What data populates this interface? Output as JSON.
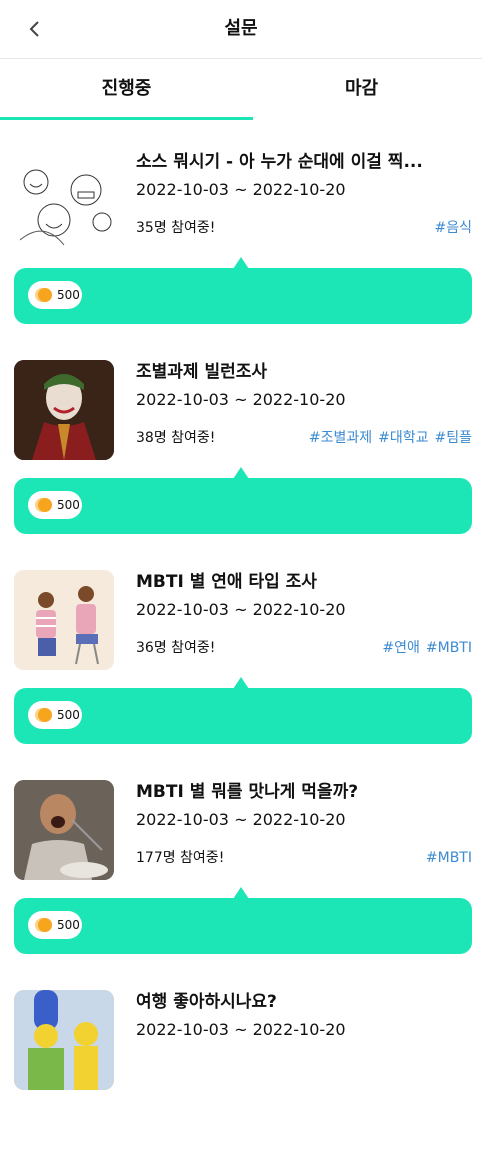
{
  "header": {
    "title": "설문",
    "back_icon": "chevron-left-icon"
  },
  "tabs": [
    {
      "label": "진행중",
      "active": true
    },
    {
      "label": "마감",
      "active": false
    }
  ],
  "colors": {
    "accent": "#1de6b6",
    "tag": "#3d8bd1",
    "coin": "#f8a51e"
  },
  "surveys": [
    {
      "title": "소스 뭐시기 - 아 누가 순대에 이걸 찍...",
      "dates": "2022-10-03 ~ 2022-10-20",
      "participants": "35명 참여중!",
      "tags": [
        "#음식"
      ],
      "reward": "500",
      "thumbnail": "meme-faces-sketch"
    },
    {
      "title": "조별과제 빌런조사",
      "dates": "2022-10-03 ~ 2022-10-20",
      "participants": "38명 참여중!",
      "tags": [
        "#조별과제",
        "#대학교",
        "#팀플"
      ],
      "reward": "500",
      "thumbnail": "joker-photo"
    },
    {
      "title": "MBTI 별 연애 타입 조사",
      "dates": "2022-10-03 ~ 2022-10-20",
      "participants": "36명 참여중!",
      "tags": [
        "#연애",
        "#MBTI"
      ],
      "reward": "500",
      "thumbnail": "couple-illustration"
    },
    {
      "title": "MBTI 별 뭐를 맛나게 먹을까?",
      "dates": "2022-10-03 ~ 2022-10-20",
      "participants": "177명 참여중!",
      "tags": [
        "#MBTI"
      ],
      "reward": "500",
      "thumbnail": "eating-man-photo"
    },
    {
      "title": "여행 좋아하시나요?",
      "dates": "2022-10-03 ~ 2022-10-20",
      "participants": "",
      "tags": [],
      "reward": "",
      "thumbnail": "cartoon-family"
    }
  ]
}
